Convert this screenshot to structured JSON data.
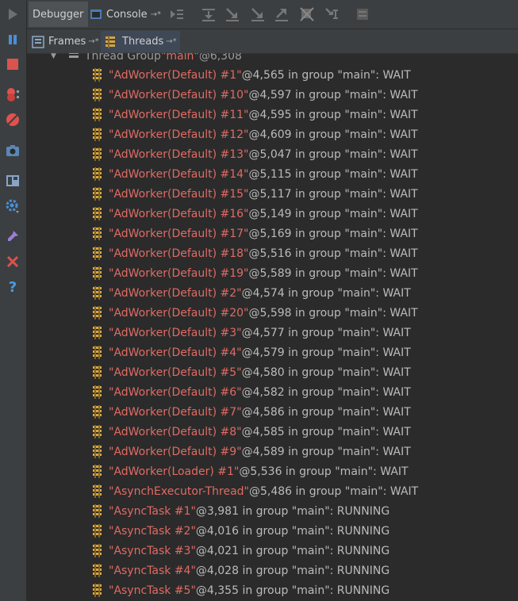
{
  "toolbar": {
    "debugger_tab": "Debugger",
    "console_tab": "Console",
    "console_arrow": "→*",
    "frames_tab": "Frames",
    "frames_arrow": "→*",
    "threads_tab": "Threads",
    "threads_arrow": "→*"
  },
  "group": {
    "prefix": "Thread Group ",
    "name": "\"main\"",
    "suffix": "@6,308"
  },
  "threads": [
    {
      "name": "\"AdWorker(Default) #1\"",
      "rest": "@4,565 in group \"main\": WAIT"
    },
    {
      "name": "\"AdWorker(Default) #10\"",
      "rest": "@4,597 in group \"main\": WAIT"
    },
    {
      "name": "\"AdWorker(Default) #11\"",
      "rest": "@4,595 in group \"main\": WAIT"
    },
    {
      "name": "\"AdWorker(Default) #12\"",
      "rest": "@4,609 in group \"main\": WAIT"
    },
    {
      "name": "\"AdWorker(Default) #13\"",
      "rest": "@5,047 in group \"main\": WAIT"
    },
    {
      "name": "\"AdWorker(Default) #14\"",
      "rest": "@5,115 in group \"main\": WAIT"
    },
    {
      "name": "\"AdWorker(Default) #15\"",
      "rest": "@5,117 in group \"main\": WAIT"
    },
    {
      "name": "\"AdWorker(Default) #16\"",
      "rest": "@5,149 in group \"main\": WAIT"
    },
    {
      "name": "\"AdWorker(Default) #17\"",
      "rest": "@5,169 in group \"main\": WAIT"
    },
    {
      "name": "\"AdWorker(Default) #18\"",
      "rest": "@5,516 in group \"main\": WAIT"
    },
    {
      "name": "\"AdWorker(Default) #19\"",
      "rest": "@5,589 in group \"main\": WAIT"
    },
    {
      "name": "\"AdWorker(Default) #2\"",
      "rest": "@4,574 in group \"main\": WAIT"
    },
    {
      "name": "\"AdWorker(Default) #20\"",
      "rest": "@5,598 in group \"main\": WAIT"
    },
    {
      "name": "\"AdWorker(Default) #3\"",
      "rest": "@4,577 in group \"main\": WAIT"
    },
    {
      "name": "\"AdWorker(Default) #4\"",
      "rest": "@4,579 in group \"main\": WAIT"
    },
    {
      "name": "\"AdWorker(Default) #5\"",
      "rest": "@4,580 in group \"main\": WAIT"
    },
    {
      "name": "\"AdWorker(Default) #6\"",
      "rest": "@4,582 in group \"main\": WAIT"
    },
    {
      "name": "\"AdWorker(Default) #7\"",
      "rest": "@4,586 in group \"main\": WAIT"
    },
    {
      "name": "\"AdWorker(Default) #8\"",
      "rest": "@4,585 in group \"main\": WAIT"
    },
    {
      "name": "\"AdWorker(Default) #9\"",
      "rest": "@4,589 in group \"main\": WAIT"
    },
    {
      "name": "\"AdWorker(Loader) #1\"",
      "rest": "@5,536 in group \"main\": WAIT"
    },
    {
      "name": "\"AsynchExecutor-Thread\"",
      "rest": "@5,486 in group \"main\": WAIT"
    },
    {
      "name": "\"AsyncTask #1\"",
      "rest": "@3,981 in group \"main\": RUNNING"
    },
    {
      "name": "\"AsyncTask #2\"",
      "rest": "@4,016 in group \"main\": RUNNING"
    },
    {
      "name": "\"AsyncTask #3\"",
      "rest": "@4,021 in group \"main\": RUNNING"
    },
    {
      "name": "\"AsyncTask #4\"",
      "rest": "@4,028 in group \"main\": RUNNING"
    },
    {
      "name": "\"AsyncTask #5\"",
      "rest": "@4,355 in group \"main\": RUNNING"
    }
  ],
  "colors": {
    "thread_name": "#e06b64",
    "background": "#2b2b2b",
    "panel": "#3c3f41"
  }
}
